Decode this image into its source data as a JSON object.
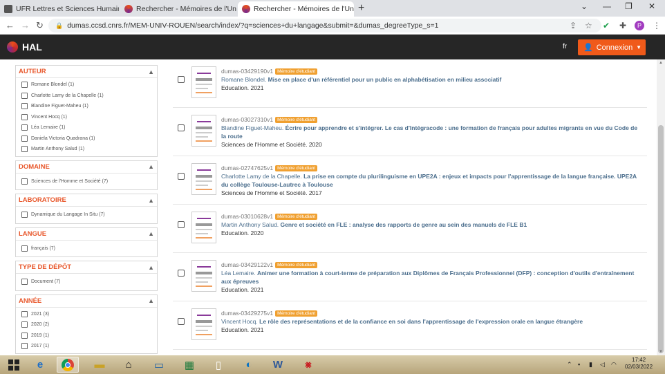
{
  "browser": {
    "tabs": [
      {
        "title": "UFR Lettres et Sciences Humaine",
        "active": false
      },
      {
        "title": "Rechercher - Mémoires de l'Univ",
        "active": false
      },
      {
        "title": "Rechercher - Mémoires de l'Univ",
        "active": true
      }
    ],
    "url": "dumas.ccsd.cnrs.fr/MEM-UNIV-ROUEN/search/index/?q=sciences+du+langage&submit=&dumas_degreeType_s=1",
    "profile_initial": "P"
  },
  "header": {
    "logo": "HAL",
    "lang": "fr",
    "login_label": "Connexion"
  },
  "facets": [
    {
      "title": "AUTEUR",
      "items": [
        "Romane Blondel (1)",
        "Charlotte Lamy de la Chapelle (1)",
        "Blandine Figuet-Maheu (1)",
        "Vincent Hocq (1)",
        "Léa Lemaire (1)",
        "Daniela Victoria Quadrana (1)",
        "Martin Anthony Salud (1)"
      ]
    },
    {
      "title": "DOMAINE",
      "items": [
        "Sciences de l'Homme et Société (7)"
      ]
    },
    {
      "title": "LABORATOIRE",
      "items": [
        "Dynamique du Langage In Situ (7)"
      ]
    },
    {
      "title": "LANGUE",
      "items": [
        "français (7)"
      ]
    },
    {
      "title": "TYPE DE DÉPÔT",
      "items": [
        "Document (7)"
      ]
    },
    {
      "title": "ANNÉE",
      "items": [
        "2021 (3)",
        "2020 (2)",
        "2019 (1)",
        "2017 (1)"
      ]
    }
  ],
  "results": [
    {
      "id": "dumas-03429190",
      "ver": "v1",
      "badge": "Mémoire d'étudiant",
      "author": "Romane Blondel.",
      "title": "Mise en place d'un référentiel pour un public en alphabétisation en milieu associatif",
      "meta": "Education. 2021"
    },
    {
      "id": "dumas-03027310",
      "ver": "v1",
      "badge": "Mémoire d'étudiant",
      "author": "Blandine Figuet-Maheu.",
      "title": "Écrire pour apprendre et s'intégrer. Le cas d'Intégracode : une formation de français pour adultes migrants en vue du Code de la route",
      "meta": "Sciences de l'Homme et Société. 2020"
    },
    {
      "id": "dumas-02747625",
      "ver": "v1",
      "badge": "Mémoire d'étudiant",
      "author": "Charlotte Lamy de la Chapelle.",
      "title": "La prise en compte du plurilinguisme en UPE2A : enjeux et impacts pour l'apprentissage de la langue française. UPE2A du collège Toulouse-Lautrec à Toulouse",
      "meta": "Sciences de l'Homme et Société. 2017"
    },
    {
      "id": "dumas-03010628",
      "ver": "v1",
      "badge": "Mémoire d'étudiant",
      "author": "Martin Anthony Salud.",
      "title": "Genre et société en FLE : analyse des rapports de genre au sein des manuels de FLE B1",
      "meta": "Education. 2020"
    },
    {
      "id": "dumas-03429122",
      "ver": "v1",
      "badge": "Mémoire d'étudiant",
      "author": "Léa Lemaire.",
      "title": "Animer une formation à court-terme de préparation aux Diplômes de Français Professionnel (DFP) : conception d'outils d'entraînement aux épreuves",
      "meta": "Education. 2021"
    },
    {
      "id": "dumas-03429275",
      "ver": "v1",
      "badge": "Mémoire d'étudiant",
      "author": "Vincent Hocq.",
      "title": "Le rôle des représentations et de la confiance en soi dans l'apprentissage de l'expression orale en langue étrangère",
      "meta": "Education. 2021"
    }
  ],
  "taskbar": {
    "time": "17:42",
    "date": "02/03/2022"
  }
}
